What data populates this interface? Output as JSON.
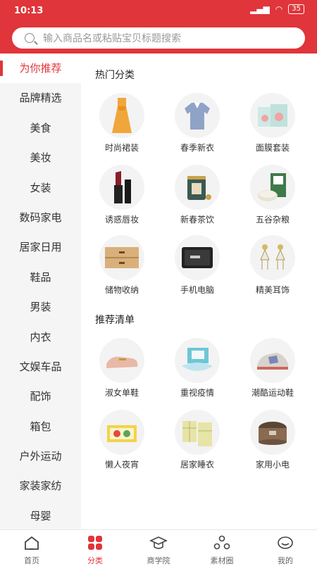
{
  "status": {
    "time": "10:13",
    "battery": "35"
  },
  "search": {
    "placeholder": "输入商品名或粘贴宝贝标题搜索"
  },
  "sidebar": {
    "items": [
      {
        "label": "为你推荐"
      },
      {
        "label": "品牌精选"
      },
      {
        "label": "美食"
      },
      {
        "label": "美妆"
      },
      {
        "label": "女装"
      },
      {
        "label": "数码家电"
      },
      {
        "label": "居家日用"
      },
      {
        "label": "鞋品"
      },
      {
        "label": "男装"
      },
      {
        "label": "内衣"
      },
      {
        "label": "文娱车品"
      },
      {
        "label": "配饰"
      },
      {
        "label": "箱包"
      },
      {
        "label": "户外运动"
      },
      {
        "label": "家装家纺"
      },
      {
        "label": "母婴"
      }
    ]
  },
  "sections": {
    "hot": {
      "title": "热门分类",
      "items": [
        {
          "label": "时尚裙装",
          "icon": "dress-icon"
        },
        {
          "label": "春季新衣",
          "icon": "shirt-icon"
        },
        {
          "label": "面膜套装",
          "icon": "facemask-box-icon"
        },
        {
          "label": "诱惑唇妆",
          "icon": "lipstick-icon"
        },
        {
          "label": "新春茶饮",
          "icon": "tea-tin-icon"
        },
        {
          "label": "五谷杂粮",
          "icon": "grain-bag-icon"
        },
        {
          "label": "储物收纳",
          "icon": "drawer-cabinet-icon"
        },
        {
          "label": "手机电脑",
          "icon": "phone-icon"
        },
        {
          "label": "精美耳饰",
          "icon": "earrings-icon"
        }
      ]
    },
    "recommend": {
      "title": "推荐清单",
      "items": [
        {
          "label": "淑女单鞋",
          "icon": "loafer-icon"
        },
        {
          "label": "重视疫情",
          "icon": "face-mask-icon"
        },
        {
          "label": "潮酷运动鞋",
          "icon": "sneaker-icon"
        },
        {
          "label": "懒人夜宵",
          "icon": "snack-box-icon"
        },
        {
          "label": "居家睡衣",
          "icon": "pajamas-icon"
        },
        {
          "label": "家用小电",
          "icon": "rice-cooker-icon"
        }
      ]
    }
  },
  "tabbar": {
    "items": [
      {
        "label": "首页",
        "icon": "home-icon"
      },
      {
        "label": "分类",
        "icon": "category-icon"
      },
      {
        "label": "商学院",
        "icon": "graduation-cap-icon"
      },
      {
        "label": "素材圈",
        "icon": "circle-group-icon"
      },
      {
        "label": "我的",
        "icon": "profile-icon"
      }
    ]
  },
  "colors": {
    "brand": "#e0353a"
  }
}
